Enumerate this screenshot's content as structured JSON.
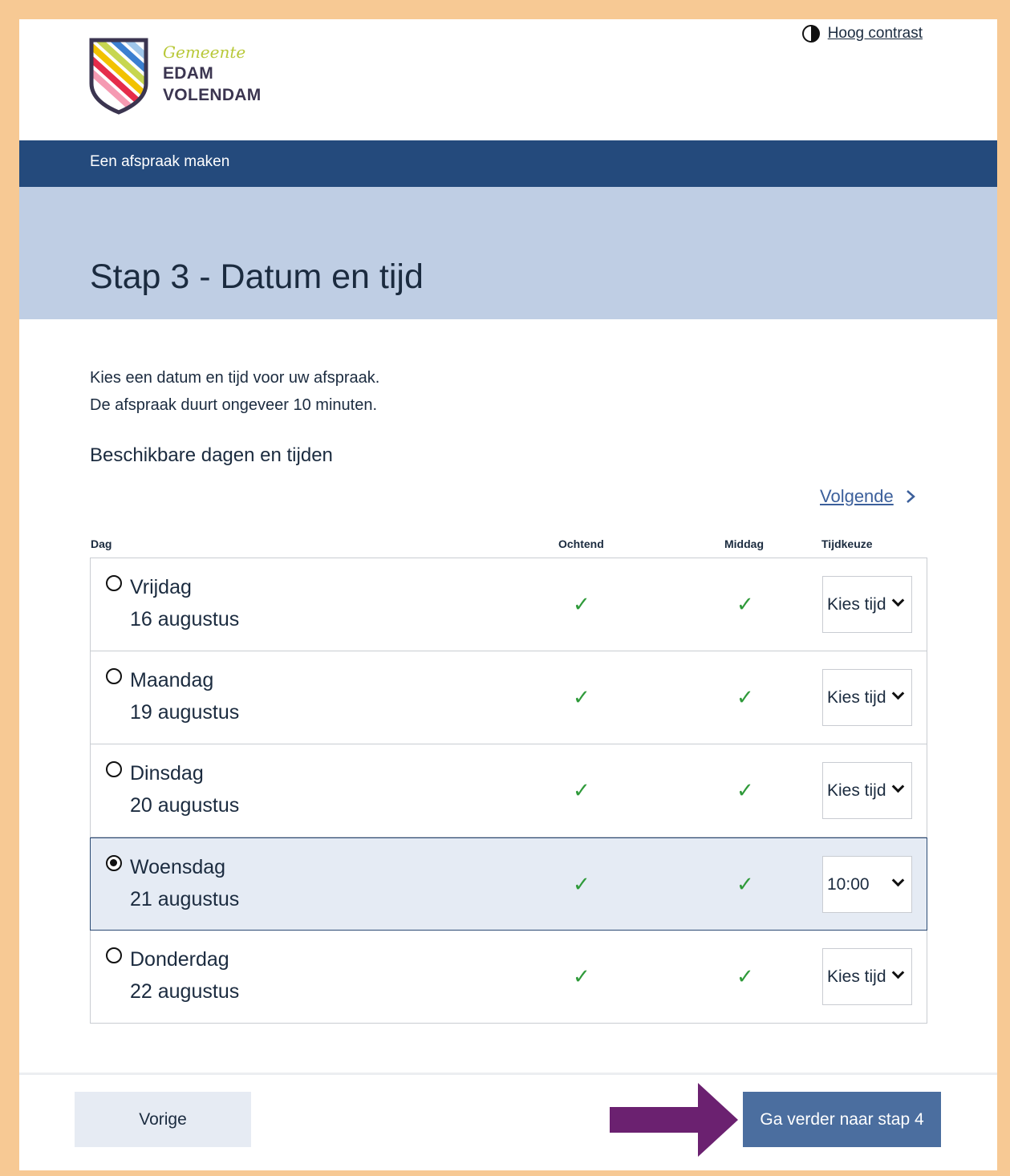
{
  "header": {
    "logo_small": "Gemeente",
    "logo_line1": "EDAM",
    "logo_line2": "VOLENDAM",
    "contrast_label": "Hoog contrast"
  },
  "nav": {
    "title": "Een afspraak maken"
  },
  "hero": {
    "title": "Stap 3 - Datum en tijd"
  },
  "intro": {
    "line1": "Kies een datum en tijd voor uw afspraak.",
    "line2": "De afspraak duurt ongeveer 10 minuten."
  },
  "section_title": "Beschikbare dagen en tijden",
  "next_link": "Volgende",
  "table": {
    "headers": {
      "day": "Dag",
      "morning": "Ochtend",
      "afternoon": "Middag",
      "time": "Tijdkeuze"
    },
    "rows": [
      {
        "day": "Vrijdag",
        "date": "16 augustus",
        "morning": "✓",
        "afternoon": "✓",
        "time": "Kies tijd"
      },
      {
        "day": "Maandag",
        "date": "19 augustus",
        "morning": "✓",
        "afternoon": "✓",
        "time": "Kies tijd"
      },
      {
        "day": "Dinsdag",
        "date": "20 augustus",
        "morning": "✓",
        "afternoon": "✓",
        "time": "Kies tijd"
      },
      {
        "day": "Woensdag",
        "date": "21 augustus",
        "morning": "✓",
        "afternoon": "✓",
        "time": "10:00",
        "selected": true
      },
      {
        "day": "Donderdag",
        "date": "22 augustus",
        "morning": "✓",
        "afternoon": "✓",
        "time": "Kies tijd"
      }
    ]
  },
  "footer": {
    "prev_label": "Vorige",
    "next_label": "Ga verder naar stap 4"
  },
  "colors": {
    "frame": "#f7c994",
    "navbar": "#244a7c",
    "hero": "#bfcee4",
    "primary_button": "#4b6e9f",
    "check": "#2f9a3a",
    "annotation_arrow": "#6b2170"
  }
}
